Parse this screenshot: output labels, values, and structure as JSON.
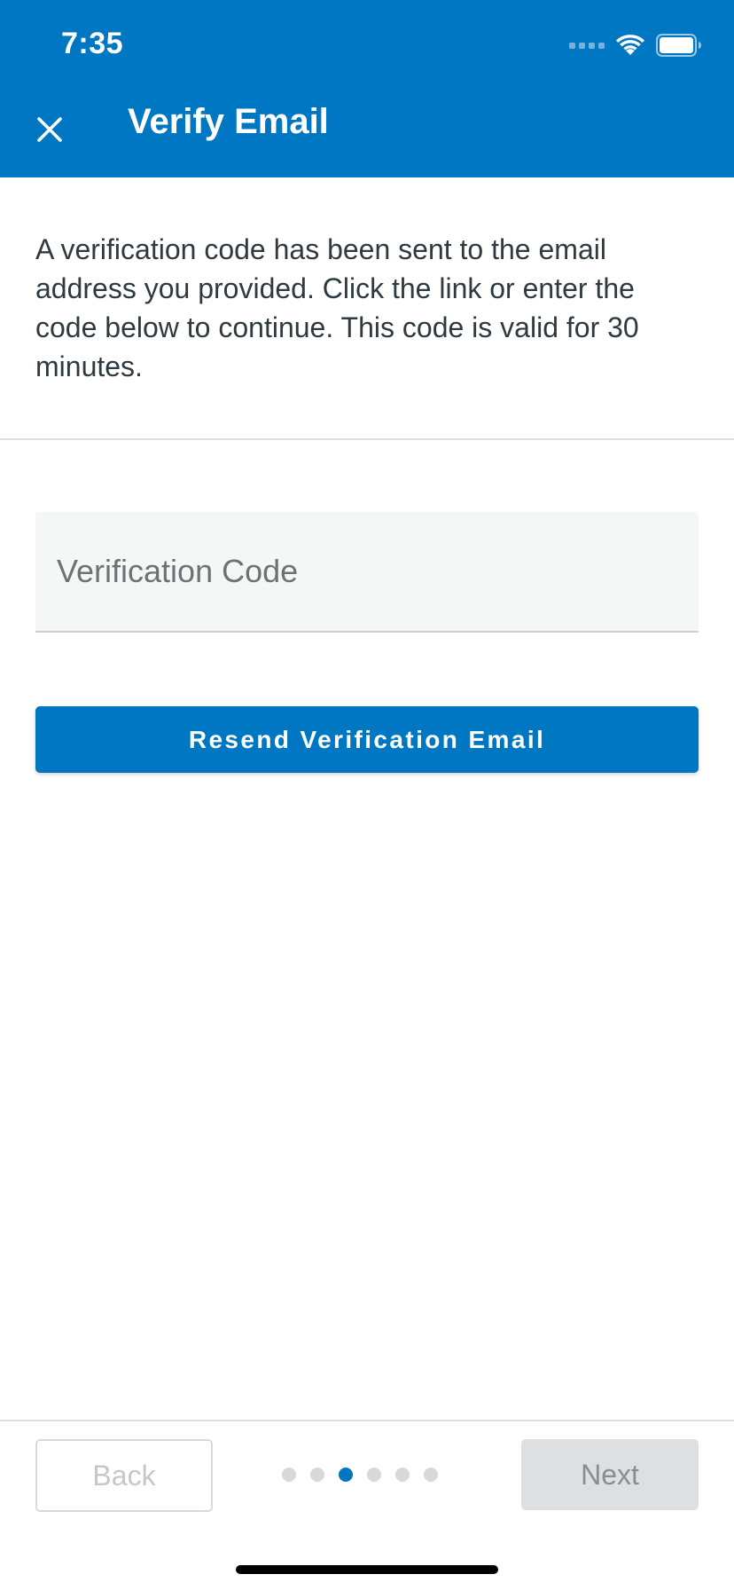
{
  "status_bar": {
    "time": "7:35",
    "signal_icon": "cellular-signal-icon",
    "wifi_icon": "wifi-icon",
    "battery_icon": "battery-icon"
  },
  "header": {
    "title": "Verify Email",
    "close_icon": "close-icon",
    "background_color": "#0077c2"
  },
  "main": {
    "description": "A verification code has been sent to the email address you provided. Click the link or enter the code below to continue. This code is valid for 30 minutes.",
    "code_field": {
      "placeholder": "Verification Code",
      "value": ""
    },
    "resend_button_label": "Resend Verification Email"
  },
  "footer": {
    "back_label": "Back",
    "next_label": "Next",
    "pager": {
      "total_steps": 6,
      "current_step": 3
    }
  },
  "colors": {
    "accent": "#0077c2",
    "text": "#2e3a40",
    "disabled_text": "#c5c8ca",
    "disabled_bg": "#dedfe0"
  }
}
